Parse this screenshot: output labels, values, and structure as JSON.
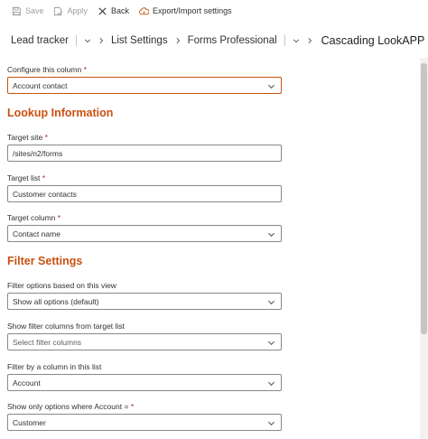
{
  "toolbar": {
    "save_label": "Save",
    "apply_label": "Apply",
    "back_label": "Back",
    "export_label": "Export/Import settings"
  },
  "breadcrumb": {
    "items": [
      "Lead tracker",
      "List Settings",
      "Forms Professional"
    ],
    "current": "Cascading LookAPP"
  },
  "form": {
    "configure": {
      "label": "Configure this column",
      "required": "*",
      "value": "Account contact"
    },
    "lookup_title": "Lookup Information",
    "target_site": {
      "label": "Target site",
      "required": "*",
      "value": "/sites/n2/forms"
    },
    "target_list": {
      "label": "Target list",
      "required": "*",
      "value": "Customer contacts"
    },
    "target_column": {
      "label": "Target column",
      "required": "*",
      "value": "Contact name"
    },
    "filter_title": "Filter Settings",
    "filter_view": {
      "label": "Filter options based on this view",
      "value": "Show all options (default)"
    },
    "filter_columns": {
      "label": "Show filter columns from target list",
      "placeholder": "Select filter columns"
    },
    "filter_by": {
      "label": "Filter by a column in this list",
      "value": "Account"
    },
    "show_only": {
      "label": "Show only options where Account =",
      "required": "*",
      "value": "Customer"
    }
  },
  "colors": {
    "accent": "#ca5010",
    "border": "#8a8886",
    "required": "#a4262c"
  }
}
